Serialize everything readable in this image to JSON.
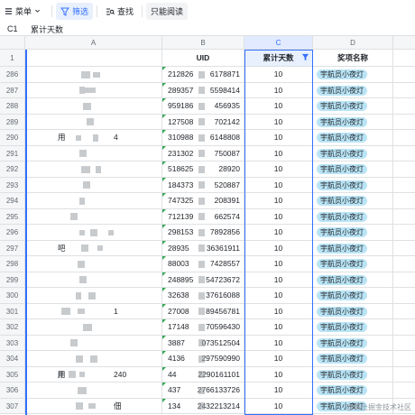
{
  "toolbar": {
    "menu_label": "菜单",
    "filter_label": "筛选",
    "search_label": "查找",
    "readonly_label": "只能阅读"
  },
  "formula_bar": {
    "cell_ref": "C1",
    "content": "累计天数"
  },
  "columns": [
    "A",
    "B",
    "C",
    "D"
  ],
  "header_row": {
    "row_num": "1",
    "a": "",
    "b": "UID",
    "c": "累计天数",
    "d": "奖项名称"
  },
  "rows": [
    {
      "num": "286",
      "uid_left": "212826",
      "uid_right": "6178871",
      "days": "10",
      "award": "宇航员小夜灯"
    },
    {
      "num": "287",
      "uid_left": "289357",
      "uid_right": "5598414",
      "days": "10",
      "award": "宇航员小夜灯"
    },
    {
      "num": "288",
      "uid_left": "959186",
      "uid_right": "456935",
      "days": "10",
      "award": "宇航员小夜灯"
    },
    {
      "num": "289",
      "uid_left": "127508",
      "uid_right": "702142",
      "days": "10",
      "award": "宇航员小夜灯"
    },
    {
      "num": "290",
      "uid_left": "310988",
      "uid_right": "6148808",
      "days": "10",
      "award": "宇航员小夜灯",
      "a_text": "用",
      "a_text2": "4"
    },
    {
      "num": "291",
      "uid_left": "231302",
      "uid_right": "750087",
      "days": "10",
      "award": "宇航员小夜灯"
    },
    {
      "num": "292",
      "uid_left": "518625",
      "uid_right": "28920",
      "days": "10",
      "award": "宇航员小夜灯"
    },
    {
      "num": "293",
      "uid_left": "184373",
      "uid_right": "520887",
      "days": "10",
      "award": "宇航员小夜灯"
    },
    {
      "num": "294",
      "uid_left": "747325",
      "uid_right": "208391",
      "days": "10",
      "award": "宇航员小夜灯"
    },
    {
      "num": "295",
      "uid_left": "712139",
      "uid_right": "662574",
      "days": "10",
      "award": "宇航员小夜灯"
    },
    {
      "num": "296",
      "uid_left": "298153",
      "uid_right": "7892856",
      "days": "10",
      "award": "宇航员小夜灯"
    },
    {
      "num": "297",
      "uid_left": "28935",
      "uid_right": "36361911",
      "days": "10",
      "award": "宇航员小夜灯",
      "a_text": "吧"
    },
    {
      "num": "298",
      "uid_left": "88003",
      "uid_right": "7428557",
      "days": "10",
      "award": "宇航员小夜灯"
    },
    {
      "num": "299",
      "uid_left": "248895",
      "uid_right": "54723672",
      "days": "10",
      "award": "宇航员小夜灯"
    },
    {
      "num": "300",
      "uid_left": "32638",
      "uid_right": "37616088",
      "days": "10",
      "award": "宇航员小夜灯"
    },
    {
      "num": "301",
      "uid_left": "27008",
      "uid_right": "89456781",
      "days": "10",
      "award": "宇航员小夜灯",
      "a_text2": "1"
    },
    {
      "num": "302",
      "uid_left": "17148",
      "uid_right": "70596430",
      "days": "10",
      "award": "宇航员小夜灯"
    },
    {
      "num": "303",
      "uid_left": "3887",
      "uid_right": "073512504",
      "days": "10",
      "award": "宇航员小夜灯"
    },
    {
      "num": "304",
      "uid_left": "4136",
      "uid_right": "297590990",
      "days": "10",
      "award": "宇航员小夜灯"
    },
    {
      "num": "305",
      "uid_left": "44",
      "uid_right": "2290161101",
      "days": "10",
      "award": "宇航员小夜灯",
      "a_text": "用",
      "a_text2": "240"
    },
    {
      "num": "306",
      "uid_left": "437",
      "uid_right": "2766133726",
      "days": "10",
      "award": "宇航员小夜灯"
    },
    {
      "num": "307",
      "uid_left": "134",
      "uid_right": "2432213214",
      "days": "10",
      "award": "宇航员小夜灯",
      "a_text2": "佃"
    }
  ],
  "watermark": "@稀土掘金技术社区",
  "colors": {
    "accent": "#3370ff",
    "tag_bg": "#b9e4f5",
    "grid": "#dee0e3"
  }
}
